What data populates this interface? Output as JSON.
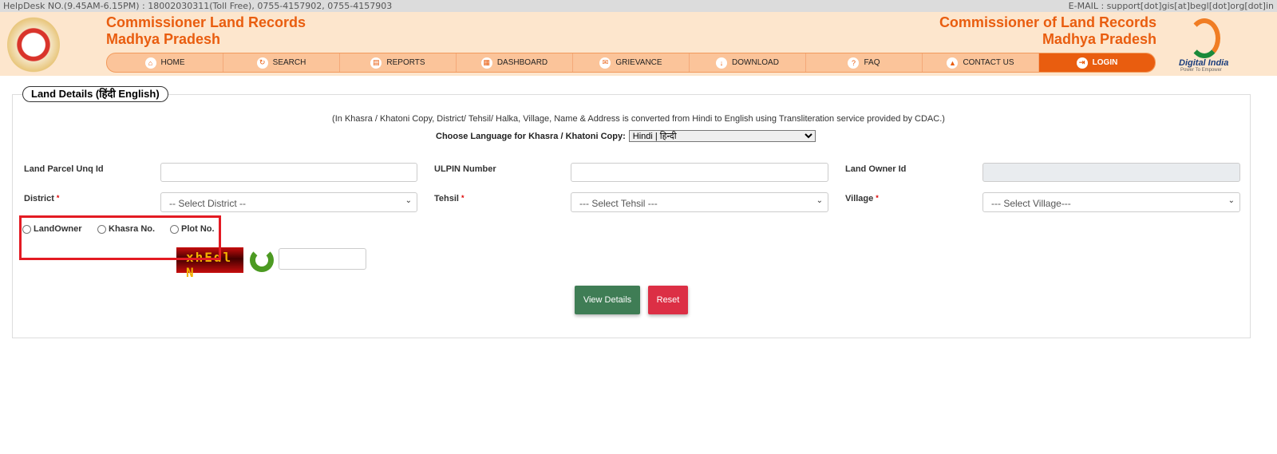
{
  "topbar": {
    "helpdesk": "HelpDesk NO.(9.45AM-6.15PM) : 18002030311(Toll Free), 0755-4157902, 0755-4157903",
    "email": "E-MAIL : support[dot]gis[at]begl[dot]org[dot]in"
  },
  "header": {
    "left_title_1": "Commissioner Land Records",
    "left_title_2": "Madhya Pradesh",
    "right_title_1": "Commissioner of Land Records",
    "right_title_2": "Madhya Pradesh",
    "digital_india": "Digital India",
    "digital_india_tag": "Power To Empower",
    "accent": "#e95d0f"
  },
  "nav": [
    {
      "label": "HOME",
      "icon": "home-icon",
      "g": "⌂"
    },
    {
      "label": "SEARCH",
      "icon": "refresh-search-icon",
      "g": "↻"
    },
    {
      "label": "REPORTS",
      "icon": "report-icon",
      "g": "▤"
    },
    {
      "label": "DASHBOARD",
      "icon": "dashboard-icon",
      "g": "▦"
    },
    {
      "label": "GRIEVANCE",
      "icon": "grievance-icon",
      "g": "✉"
    },
    {
      "label": "DOWNLOAD",
      "icon": "download-icon",
      "g": "↓"
    },
    {
      "label": "FAQ",
      "icon": "faq-icon",
      "g": "?"
    },
    {
      "label": "CONTACT US",
      "icon": "contact-icon",
      "g": "▲"
    },
    {
      "label": "LOGIN",
      "icon": "login-icon",
      "g": "⇥"
    }
  ],
  "form": {
    "legend": "Land Details  (हिंदी  English)",
    "note": "(In Khasra / Khatoni Copy, District/ Tehsil/ Halka, Village, Name & Address is converted from Hindi to English using Transliteration service provided by CDAC.)",
    "lang_label": "Choose Language for Khasra / Khatoni Copy:",
    "lang_value": "Hindi | हिन्दी",
    "land_parcel_label": "Land Parcel Unq Id",
    "ulpin_label": "ULPIN Number",
    "owner_id_label": "Land Owner Id",
    "district_label": "District",
    "district_value": "-- Select District --",
    "tehsil_label": "Tehsil",
    "tehsil_value": "--- Select Tehsil ---",
    "village_label": "Village",
    "village_value": "--- Select Village---",
    "required_mark": "*",
    "radios": [
      "LandOwner",
      "Khasra No.",
      "Plot No."
    ],
    "captcha_text": "xhEdl N",
    "view_button": "View Details",
    "reset_button": "Reset"
  }
}
